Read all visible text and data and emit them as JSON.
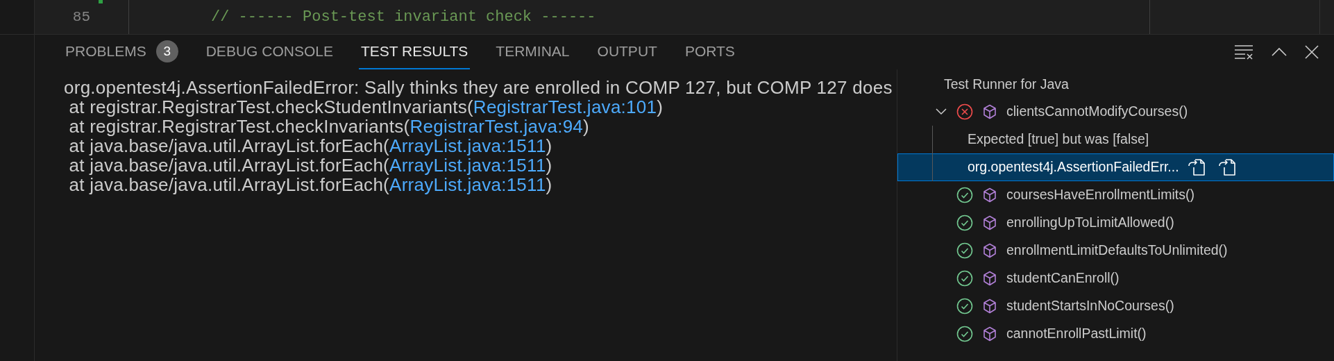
{
  "editor": {
    "line_number": "85",
    "code": "// ------ Post-test invariant check ------"
  },
  "panel": {
    "tabs": [
      {
        "label": "PROBLEMS",
        "badge": "3",
        "selected": false
      },
      {
        "label": "DEBUG CONSOLE",
        "selected": false
      },
      {
        "label": "TEST RESULTS",
        "selected": true
      },
      {
        "label": "TERMINAL",
        "selected": false
      },
      {
        "label": "OUTPUT",
        "selected": false
      },
      {
        "label": "PORTS",
        "selected": false
      }
    ]
  },
  "output": {
    "lines": [
      {
        "text": "org.opentest4j.AssertionFailedError: Sally thinks they are enrolled in COMP 127, but COMP 127 does"
      },
      {
        "text": " at registrar.RegistrarTest.checkStudentInvariants(",
        "link": "RegistrarTest.java:101",
        "suffix": ")"
      },
      {
        "text": " at registrar.RegistrarTest.checkInvariants(",
        "link": "RegistrarTest.java:94",
        "suffix": ")"
      },
      {
        "text": " at java.base/java.util.ArrayList.forEach(",
        "link": "ArrayList.java:1511",
        "suffix": ")"
      },
      {
        "text": " at java.base/java.util.ArrayList.forEach(",
        "link": "ArrayList.java:1511",
        "suffix": ")"
      },
      {
        "text": " at java.base/java.util.ArrayList.forEach(",
        "link": "ArrayList.java:1511",
        "suffix": ")"
      }
    ]
  },
  "test_tree": {
    "title": "Test Runner for Java",
    "items": [
      {
        "label": "clientsCannotModifyCourses()",
        "passed": false,
        "expanded": true,
        "selected": false,
        "children": [
          {
            "label": "Expected [true] but was [false]",
            "selected": false
          },
          {
            "label": "org.opentest4j.AssertionFailedErr...",
            "selected": true
          }
        ]
      },
      {
        "label": "coursesHaveEnrollmentLimits()",
        "passed": true,
        "selected": false
      },
      {
        "label": "enrollingUpToLimitAllowed()",
        "passed": true,
        "selected": false
      },
      {
        "label": "enrollmentLimitDefaultsToUnlimited()",
        "passed": true,
        "selected": false
      },
      {
        "label": "studentCanEnroll()",
        "passed": true,
        "selected": false
      },
      {
        "label": "studentStartsInNoCourses()",
        "passed": true,
        "selected": false
      },
      {
        "label": "cannotEnrollPastLimit()",
        "passed": true,
        "selected": false
      }
    ]
  }
}
